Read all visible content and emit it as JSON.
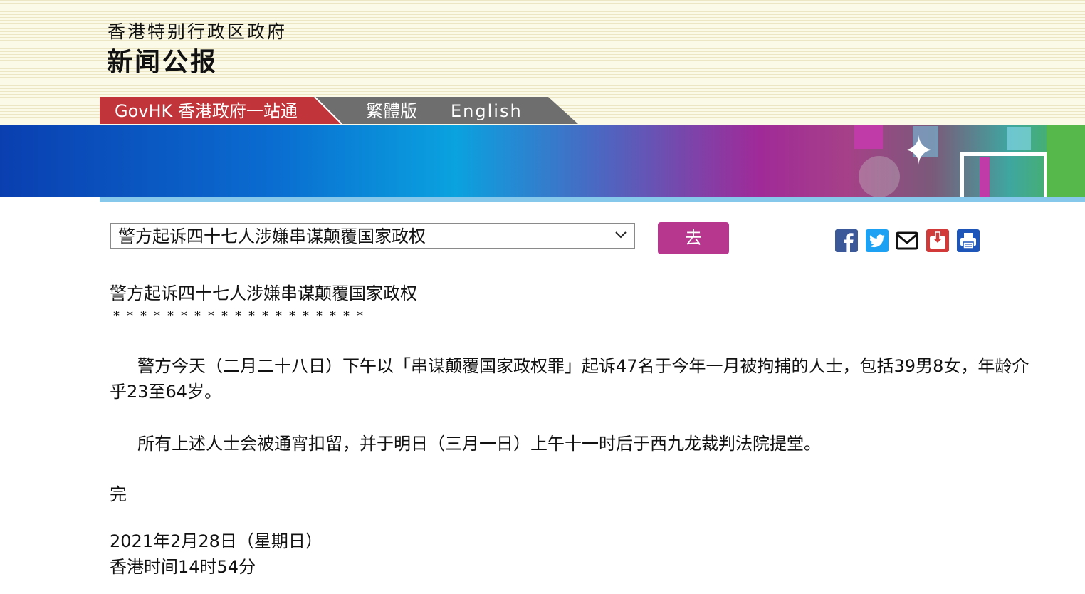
{
  "header": {
    "gov_name": "香港特别行政区政府",
    "site_title": "新闻公报",
    "nav": {
      "govhk": "GovHK 香港政府一站通",
      "traditional": "繁體版",
      "english": "English"
    }
  },
  "controls": {
    "select_value": "警方起诉四十七人涉嫌串谋颠覆国家政权",
    "go_label": "去",
    "share_icons": [
      "facebook-icon",
      "twitter-icon",
      "email-icon",
      "download-icon",
      "print-icon"
    ]
  },
  "article": {
    "title": "警方起诉四十七人涉嫌串谋颠覆国家政权",
    "stars": "*******************",
    "paragraphs": [
      "警方今天（二月二十八日）下午以「串谋颠覆国家政权罪」起诉47名于今年一月被拘捕的人士，包括39男8女，年龄介乎23至64岁。",
      "所有上述人士会被通宵扣留，并于明日（三月一日）上午十一时后于西九龙裁判法院提堂。"
    ],
    "end": "完",
    "date": "2021年2月28日（星期日）",
    "time": "香港时间14时54分"
  },
  "colors": {
    "nav_red": "#c0343a",
    "nav_gray": "#6e6e6e",
    "go_button": "#b7378f",
    "facebook": "#3b5998",
    "twitter": "#1da1f2",
    "download": "#d23a3a",
    "print": "#1e55b8"
  }
}
